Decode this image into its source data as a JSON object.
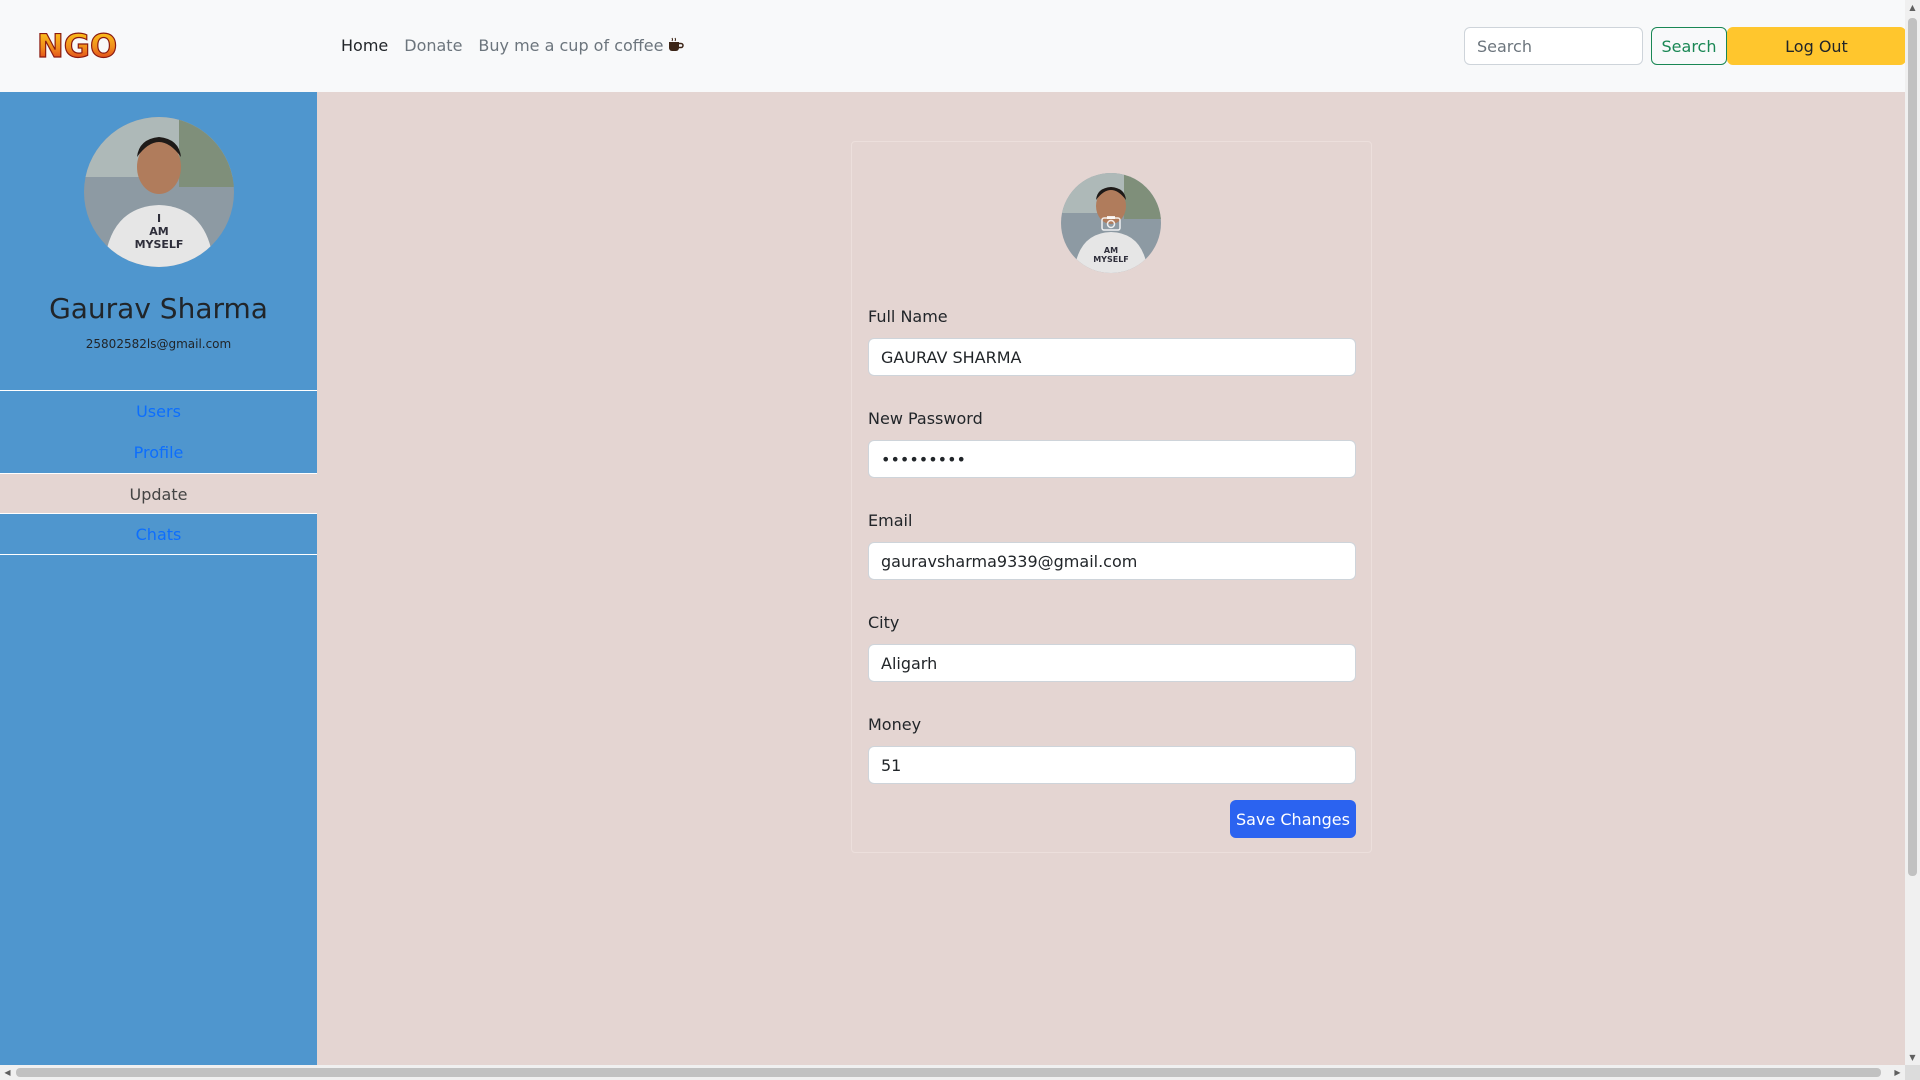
{
  "brand": {
    "logo_text": "NGO"
  },
  "nav": {
    "links": [
      {
        "label": "Home"
      },
      {
        "label": "Donate"
      },
      {
        "label": "Buy me a cup of coffee"
      }
    ],
    "search_placeholder": "Search",
    "search_button": "Search",
    "logout_button": "Log Out"
  },
  "sidebar": {
    "name": "Gaurav Sharma",
    "email": "25802582ls@gmail.com",
    "items": [
      {
        "label": "Users"
      },
      {
        "label": "Profile"
      },
      {
        "label": "Update"
      },
      {
        "label": "Chats"
      }
    ]
  },
  "form": {
    "fields": [
      {
        "label": "Full Name",
        "value": "GAURAV SHARMA"
      },
      {
        "label": "New Password",
        "value": "•••••••••"
      },
      {
        "label": "Email",
        "value": "gauravsharma9339@gmail.com"
      },
      {
        "label": "City",
        "value": "Aligarh"
      },
      {
        "label": "Money",
        "value": "51"
      }
    ],
    "save_button": "Save Changes"
  },
  "colors": {
    "sidebar_bg": "#4f96ce",
    "page_bg": "#e4d5d2",
    "logout_bg": "#ffc62d",
    "save_bg": "#2b63f0",
    "search_border": "#198754",
    "link_blue": "#0d6efd"
  }
}
